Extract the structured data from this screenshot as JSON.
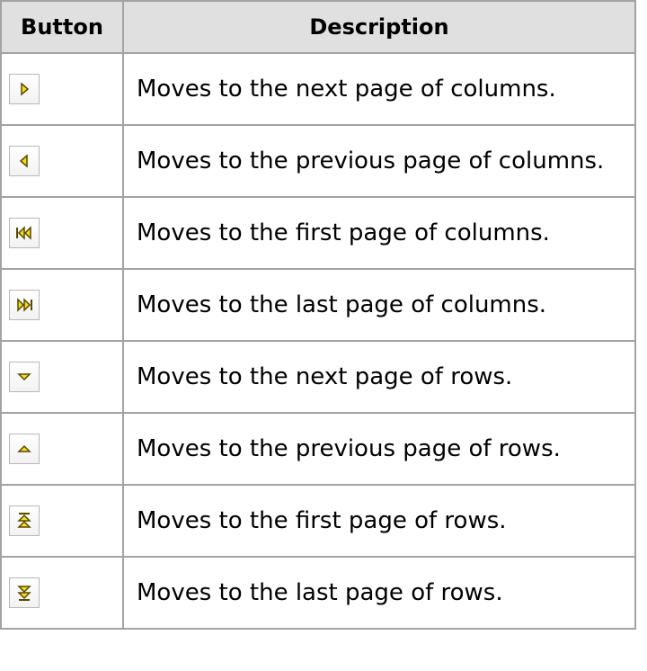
{
  "table": {
    "headers": {
      "button": "Button",
      "description": "Description"
    },
    "rows": [
      {
        "icon": "next-page-columns-icon",
        "description": "Moves to the next page of columns."
      },
      {
        "icon": "previous-page-columns-icon",
        "description": "Moves to the previous page of columns."
      },
      {
        "icon": "first-page-columns-icon",
        "description": "Moves to the first page of columns."
      },
      {
        "icon": "last-page-columns-icon",
        "description": "Moves to the last page of columns."
      },
      {
        "icon": "next-page-rows-icon",
        "description": "Moves to the next page of rows."
      },
      {
        "icon": "previous-page-rows-icon",
        "description": "Moves to the previous page of rows."
      },
      {
        "icon": "first-page-rows-icon",
        "description": "Moves to the first page of rows."
      },
      {
        "icon": "last-page-rows-icon",
        "description": "Moves to the last page of rows."
      }
    ]
  },
  "colors": {
    "header_background": "#e0e0e0",
    "border": "#a3a3a3",
    "icon_fill": "#f5dc1e",
    "icon_stroke": "#5a4a00"
  }
}
